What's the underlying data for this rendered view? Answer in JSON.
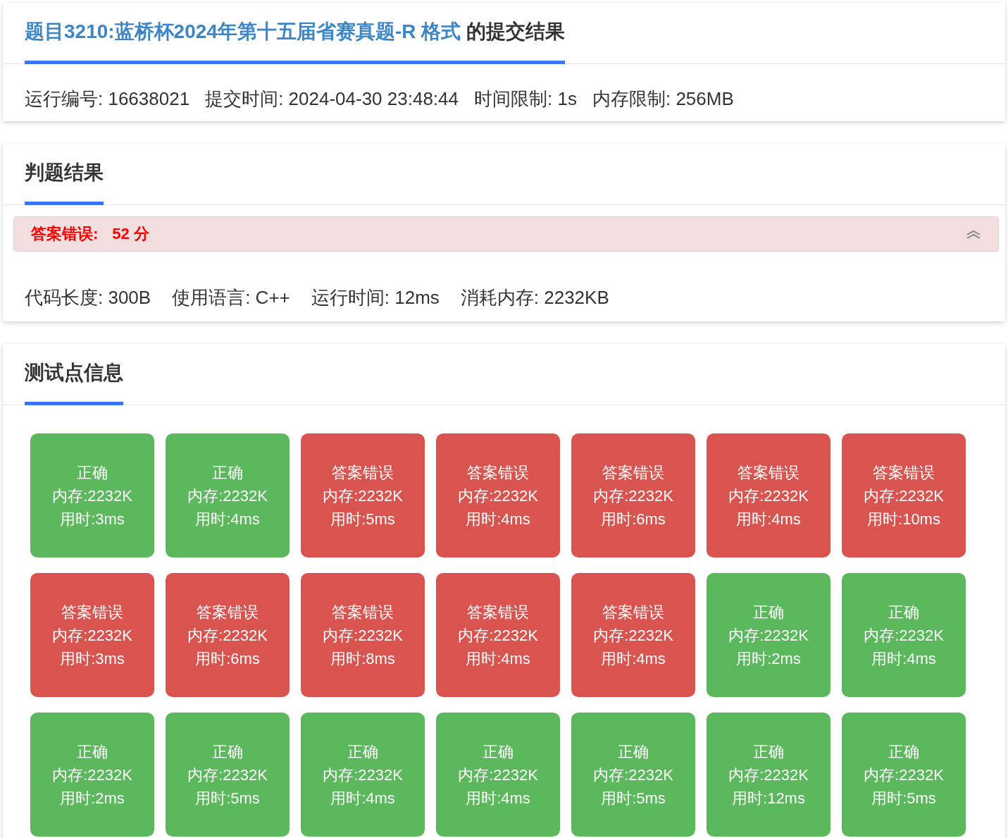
{
  "submission": {
    "title_link": "题目3210:蓝桥杯2024年第十五届省赛真题-R 格式",
    "title_suffix": "的提交结果",
    "info": [
      "运行编号: 16638021",
      "提交时间: 2024-04-30 23:48:44",
      "时间限制: 1s",
      "内存限制: 256MB"
    ]
  },
  "judge": {
    "heading": "判题结果",
    "verdict": {
      "label": "答案错误:",
      "score": "52 分",
      "expanded": true
    },
    "info": [
      "代码长度: 300B",
      "使用语言: C++",
      "运行时间: 12ms",
      "消耗内存: 2232KB"
    ]
  },
  "tests": {
    "heading": "测试点信息",
    "cases": [
      {
        "kind": "accepted",
        "status": "正确",
        "memory": "内存:2232K",
        "time": "用时:3ms"
      },
      {
        "kind": "accepted",
        "status": "正确",
        "memory": "内存:2232K",
        "time": "用时:4ms"
      },
      {
        "kind": "wrong",
        "status": "答案错误",
        "memory": "内存:2232K",
        "time": "用时:5ms"
      },
      {
        "kind": "wrong",
        "status": "答案错误",
        "memory": "内存:2232K",
        "time": "用时:4ms"
      },
      {
        "kind": "wrong",
        "status": "答案错误",
        "memory": "内存:2232K",
        "time": "用时:6ms"
      },
      {
        "kind": "wrong",
        "status": "答案错误",
        "memory": "内存:2232K",
        "time": "用时:4ms"
      },
      {
        "kind": "wrong",
        "status": "答案错误",
        "memory": "内存:2232K",
        "time": "用时:10ms"
      },
      {
        "kind": "wrong",
        "status": "答案错误",
        "memory": "内存:2232K",
        "time": "用时:3ms"
      },
      {
        "kind": "wrong",
        "status": "答案错误",
        "memory": "内存:2232K",
        "time": "用时:6ms"
      },
      {
        "kind": "wrong",
        "status": "答案错误",
        "memory": "内存:2232K",
        "time": "用时:8ms"
      },
      {
        "kind": "wrong",
        "status": "答案错误",
        "memory": "内存:2232K",
        "time": "用时:4ms"
      },
      {
        "kind": "wrong",
        "status": "答案错误",
        "memory": "内存:2232K",
        "time": "用时:4ms"
      },
      {
        "kind": "accepted",
        "status": "正确",
        "memory": "内存:2232K",
        "time": "用时:2ms"
      },
      {
        "kind": "accepted",
        "status": "正确",
        "memory": "内存:2232K",
        "time": "用时:4ms"
      },
      {
        "kind": "accepted",
        "status": "正确",
        "memory": "内存:2232K",
        "time": "用时:2ms"
      },
      {
        "kind": "accepted",
        "status": "正确",
        "memory": "内存:2232K",
        "time": "用时:5ms"
      },
      {
        "kind": "accepted",
        "status": "正确",
        "memory": "内存:2232K",
        "time": "用时:4ms"
      },
      {
        "kind": "accepted",
        "status": "正确",
        "memory": "内存:2232K",
        "time": "用时:4ms"
      },
      {
        "kind": "accepted",
        "status": "正确",
        "memory": "内存:2232K",
        "time": "用时:5ms"
      },
      {
        "kind": "accepted",
        "status": "正确",
        "memory": "内存:2232K",
        "time": "用时:12ms"
      },
      {
        "kind": "accepted",
        "status": "正确",
        "memory": "内存:2232K",
        "time": "用时:5ms"
      }
    ]
  }
}
